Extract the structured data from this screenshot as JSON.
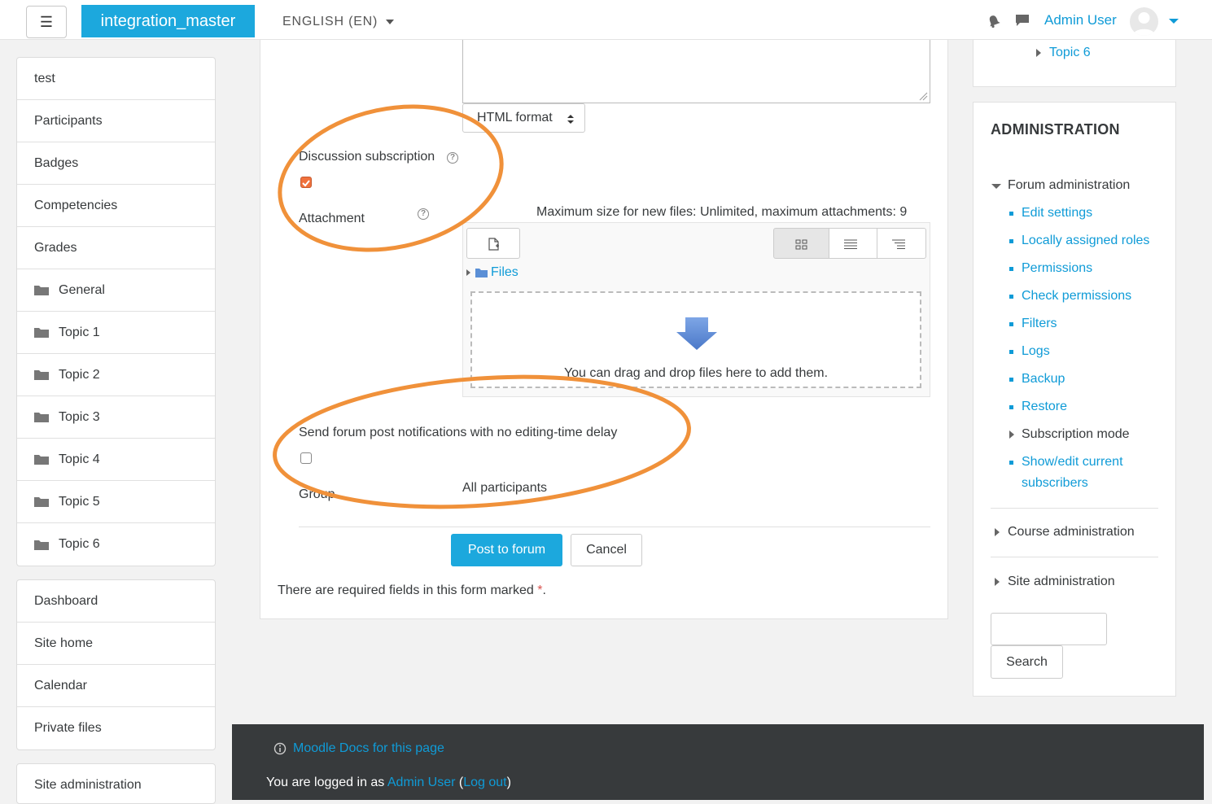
{
  "navbar": {
    "menu_icon": "☰",
    "brand": "integration_master",
    "language": "ENGLISH (EN)",
    "user_name": "Admin User",
    "icons": [
      "bell-icon",
      "chat-icon",
      "avatar",
      "chevron-down-icon"
    ]
  },
  "left_nav": {
    "course_items": [
      {
        "label": "test"
      },
      {
        "label": "Participants"
      },
      {
        "label": "Badges"
      },
      {
        "label": "Competencies"
      },
      {
        "label": "Grades"
      },
      {
        "label": "General",
        "icon": "folder-icon"
      },
      {
        "label": "Topic 1",
        "icon": "folder-icon"
      },
      {
        "label": "Topic 2",
        "icon": "folder-icon"
      },
      {
        "label": "Topic 3",
        "icon": "folder-icon"
      },
      {
        "label": "Topic 4",
        "icon": "folder-icon"
      },
      {
        "label": "Topic 5",
        "icon": "folder-icon"
      },
      {
        "label": "Topic 6",
        "icon": "folder-icon"
      }
    ],
    "site_items": [
      {
        "label": "Dashboard"
      },
      {
        "label": "Site home"
      },
      {
        "label": "Calendar"
      },
      {
        "label": "Private files"
      }
    ],
    "admin_item": {
      "label": "Site administration"
    }
  },
  "form": {
    "format_select": "HTML format",
    "discussion_subscription_label": "Discussion subscription",
    "discussion_subscription_checked": true,
    "attachment_label": "Attachment",
    "max_size_text": "Maximum size for new files: Unlimited, maximum attachments: 9",
    "files_label": "Files",
    "dropzone_text": "You can drag and drop files here to add them.",
    "no_delay_label": "Send forum post notifications with no editing-time delay",
    "no_delay_checked": false,
    "group_label": "Group",
    "group_value": "All participants",
    "submit_label": "Post to forum",
    "cancel_label": "Cancel",
    "required_note": "There are required fields in this form marked",
    "required_marker": "*",
    "required_end": "."
  },
  "right": {
    "top_link": "Topic 6",
    "admin_title": "ADMINISTRATION",
    "forum_admin": "Forum administration",
    "forum_links": [
      "Edit settings",
      "Locally assigned roles",
      "Permissions",
      "Check permissions",
      "Filters",
      "Logs",
      "Backup",
      "Restore"
    ],
    "subscription_mode": "Subscription mode",
    "show_edit_1": "Show/edit current",
    "show_edit_2": "subscribers",
    "course_admin": "Course administration",
    "site_admin": "Site administration",
    "search_placeholder": "",
    "search_button": "Search"
  },
  "footer": {
    "docs_link": "Moodle Docs for this page",
    "logged_in_prefix": "You are logged in as",
    "user_link": "Admin User",
    "open_paren": "(",
    "logout_link": "Log out",
    "close_paren": ")"
  },
  "colors": {
    "accent": "#1ca8dd",
    "link": "#0f9bd7",
    "highlight": "#f0913a",
    "footer_bg": "#373a3c"
  }
}
